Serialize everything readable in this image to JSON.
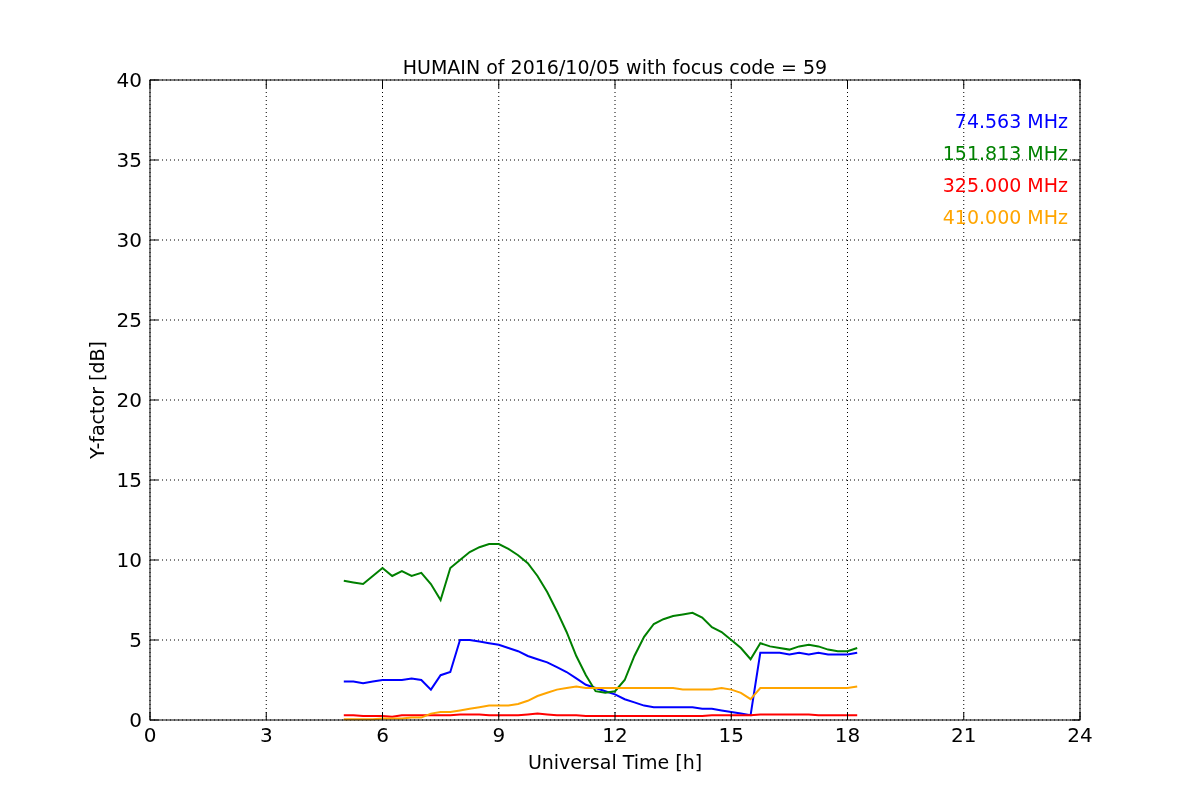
{
  "chart_data": {
    "type": "line",
    "title": "HUMAIN of 2016/10/05 with focus code = 59",
    "xlabel": "Universal Time [h]",
    "ylabel": "Y-factor [dB]",
    "x": [
      5.0,
      5.25,
      5.5,
      5.75,
      6.0,
      6.25,
      6.5,
      6.75,
      7.0,
      7.25,
      7.5,
      7.75,
      8.0,
      8.25,
      8.5,
      8.75,
      9.0,
      9.25,
      9.5,
      9.75,
      10.0,
      10.25,
      10.5,
      10.75,
      11.0,
      11.25,
      11.5,
      11.75,
      12.0,
      12.25,
      12.5,
      12.75,
      13.0,
      13.25,
      13.5,
      13.75,
      14.0,
      14.25,
      14.5,
      14.75,
      15.0,
      15.25,
      15.5,
      15.75,
      16.0,
      16.25,
      16.5,
      16.75,
      17.0,
      17.25,
      17.5,
      17.75,
      18.0,
      18.25
    ],
    "series": [
      {
        "name": "74.563 MHz",
        "color": "#0000ff",
        "values": [
          2.4,
          2.4,
          2.3,
          2.4,
          2.5,
          2.5,
          2.5,
          2.6,
          2.5,
          1.9,
          2.8,
          3.0,
          5.0,
          5.0,
          4.9,
          4.8,
          4.7,
          4.5,
          4.3,
          4.0,
          3.8,
          3.6,
          3.3,
          3.0,
          2.6,
          2.2,
          2.0,
          1.8,
          1.6,
          1.3,
          1.1,
          0.9,
          0.8,
          0.8,
          0.8,
          0.8,
          0.8,
          0.7,
          0.7,
          0.6,
          0.5,
          0.4,
          0.3,
          4.2,
          4.2,
          4.2,
          4.1,
          4.2,
          4.1,
          4.2,
          4.1,
          4.1,
          4.1,
          4.2
        ]
      },
      {
        "name": "151.813 MHz",
        "color": "#008000",
        "values": [
          8.7,
          8.6,
          8.5,
          9.0,
          9.5,
          9.0,
          9.3,
          9.0,
          9.2,
          8.5,
          7.5,
          9.5,
          10.0,
          10.5,
          10.8,
          11.0,
          11.0,
          10.7,
          10.3,
          9.8,
          9.0,
          8.0,
          6.8,
          5.5,
          4.0,
          2.8,
          1.8,
          1.7,
          1.8,
          2.5,
          4.0,
          5.2,
          6.0,
          6.3,
          6.5,
          6.6,
          6.7,
          6.4,
          5.8,
          5.5,
          5.0,
          4.5,
          3.8,
          4.8,
          4.6,
          4.5,
          4.4,
          4.6,
          4.7,
          4.6,
          4.4,
          4.3,
          4.3,
          4.5
        ]
      },
      {
        "name": "325.000 MHz",
        "color": "#ff0000",
        "values": [
          0.3,
          0.3,
          0.25,
          0.25,
          0.25,
          0.2,
          0.3,
          0.3,
          0.3,
          0.3,
          0.3,
          0.3,
          0.35,
          0.35,
          0.35,
          0.3,
          0.3,
          0.3,
          0.3,
          0.35,
          0.4,
          0.35,
          0.3,
          0.3,
          0.3,
          0.25,
          0.25,
          0.25,
          0.25,
          0.25,
          0.25,
          0.25,
          0.25,
          0.25,
          0.25,
          0.25,
          0.25,
          0.25,
          0.3,
          0.3,
          0.3,
          0.3,
          0.3,
          0.35,
          0.35,
          0.35,
          0.35,
          0.35,
          0.35,
          0.3,
          0.3,
          0.3,
          0.3,
          0.3
        ]
      },
      {
        "name": "410.000 MHz",
        "color": "#ffa500",
        "values": [
          0.05,
          0.05,
          0.05,
          0.05,
          0.1,
          0.1,
          0.1,
          0.15,
          0.15,
          0.4,
          0.5,
          0.5,
          0.6,
          0.7,
          0.8,
          0.9,
          0.9,
          0.9,
          1.0,
          1.2,
          1.5,
          1.7,
          1.9,
          2.0,
          2.1,
          2.0,
          2.0,
          2.0,
          2.0,
          2.0,
          2.0,
          2.0,
          2.0,
          2.0,
          2.0,
          1.9,
          1.9,
          1.9,
          1.9,
          2.0,
          1.9,
          1.7,
          1.3,
          2.0,
          2.0,
          2.0,
          2.0,
          2.0,
          2.0,
          2.0,
          2.0,
          2.0,
          2.0,
          2.1
        ]
      }
    ],
    "grid": true,
    "xlim": [
      0,
      24
    ],
    "ylim": [
      0,
      40
    ],
    "xticks": [
      0,
      3,
      6,
      9,
      12,
      15,
      18,
      21,
      24
    ],
    "yticks": [
      0,
      5,
      10,
      15,
      20,
      25,
      30,
      35,
      40
    ]
  }
}
